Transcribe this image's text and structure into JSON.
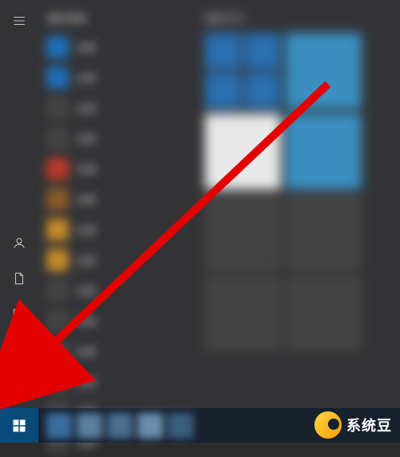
{
  "start_menu": {
    "recent_header": "最近添加",
    "tiles_header": "高效工作",
    "apps": [
      {
        "label": "应用",
        "color": "#1e6fb8"
      },
      {
        "label": "应用",
        "color": "#1e6fb8"
      },
      {
        "label": "应用",
        "color": "#444444"
      },
      {
        "label": "应用",
        "color": "#444444"
      },
      {
        "label": "应用",
        "color": "#b83a2a"
      },
      {
        "label": "应用",
        "color": "#8a5a2a"
      },
      {
        "label": "应用",
        "color": "#c48a2a"
      },
      {
        "label": "应用",
        "color": "#c48a2a"
      },
      {
        "label": "应用",
        "color": "#444444"
      },
      {
        "label": "应用",
        "color": "#444444"
      },
      {
        "label": "应用",
        "color": "#444444"
      },
      {
        "label": "应用",
        "color": "#444444"
      },
      {
        "label": "应用",
        "color": "#444444"
      },
      {
        "label": "应用",
        "color": "#444444"
      }
    ],
    "tiles": [
      {
        "color": "#2a6fb0",
        "type": "small-group",
        "small_colors": [
          "#2a6fb0",
          "#2a6fb0",
          "#2a6fb0",
          "#2a6fb0"
        ]
      },
      {
        "color": "#3a8fc0",
        "type": "medium"
      },
      {
        "color": "#e8e8e8",
        "type": "medium"
      },
      {
        "color": "#3a8fc0",
        "type": "medium"
      },
      {
        "color": "#444444",
        "type": "medium"
      },
      {
        "color": "#444444",
        "type": "medium"
      },
      {
        "color": "#444444",
        "type": "medium"
      },
      {
        "color": "#444444",
        "type": "medium"
      }
    ]
  },
  "watermark": {
    "text": "系统豆"
  }
}
